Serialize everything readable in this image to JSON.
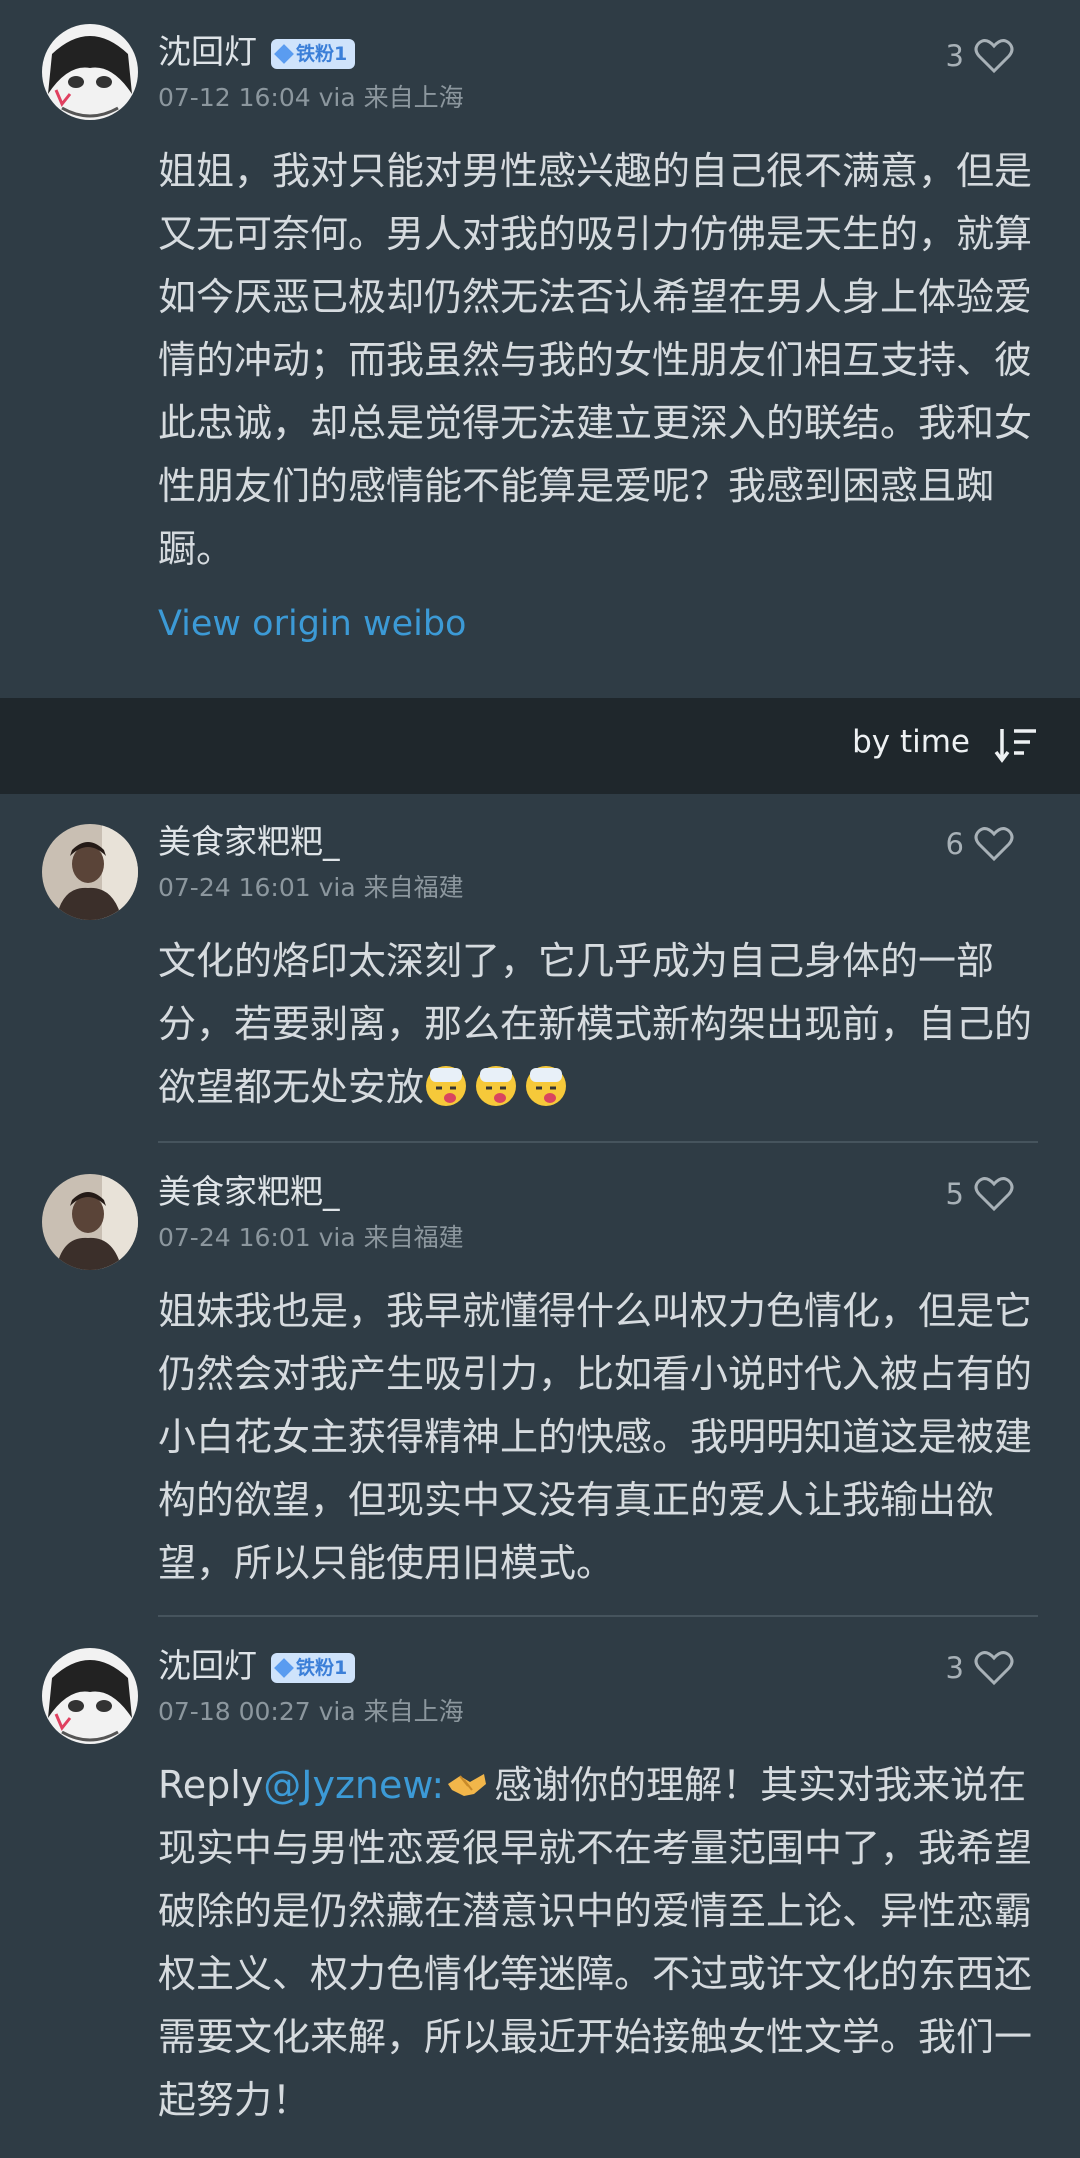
{
  "original": {
    "username": "沈回灯",
    "badge": "铁粉1",
    "meta": "07-12 16:04 via 来自上海",
    "likes": "3",
    "text": "姐姐，我对只能对男性感兴趣的自己很不满意，但是又无可奈何。男人对我的吸引力仿佛是天生的，就算如今厌恶已极却仍然无法否认希望在男人身上体验爱情的冲动；而我虽然与我的女性朋友们相互支持、彼此忠诚，却总是觉得无法建立更深入的联结。我和女性朋友们的感情能不能算是爱呢？我感到困惑且踟蹰。",
    "view_origin": "View origin weibo"
  },
  "sort": {
    "label": "by time",
    "icon": "sort-desc-icon"
  },
  "comments": [
    {
      "username": "美食家粑粑_",
      "meta": "07-24 16:01 via 来自福建",
      "likes": "6",
      "text": "文化的烙印太深刻了，它几乎成为自己身体的一部分，若要剥离，那么在新模式新构架出现前，自己的欲望都无处安放",
      "emoji_count": 3,
      "emoji": "sick-face-emoji"
    },
    {
      "username": "美食家粑粑_",
      "meta": "07-24 16:01 via 来自福建",
      "likes": "5",
      "text": "姐妹我也是，我早就懂得什么叫权力色情化，但是它仍然会对我产生吸引力，比如看小说时代入被占有的小白花女主获得精神上的快感。我明明知道这是被建构的欲望，但现实中又没有真正的爱人让我输出欲望，所以只能使用旧模式。"
    },
    {
      "username": "沈回灯",
      "badge": "铁粉1",
      "meta": "07-18 00:27 via 来自上海",
      "likes": "3",
      "reply_prefix": "Reply",
      "reply_mention": "@Jyznew:",
      "text": "感谢你的理解！其实对我来说在现实中与男性恋爱很早就不在考量范围中了，我希望破除的是仍然藏在潜意识中的爱情至上论、异性恋霸权主义、权力色情化等迷障。不过或许文化的东西还需要文化来解，所以最近开始接触女性文学。我们一起努力！"
    }
  ],
  "colors": {
    "background": "#2f3c45",
    "sortbar": "#1f272c",
    "link": "#3c9ad6",
    "badge": "#cfe3fb"
  }
}
